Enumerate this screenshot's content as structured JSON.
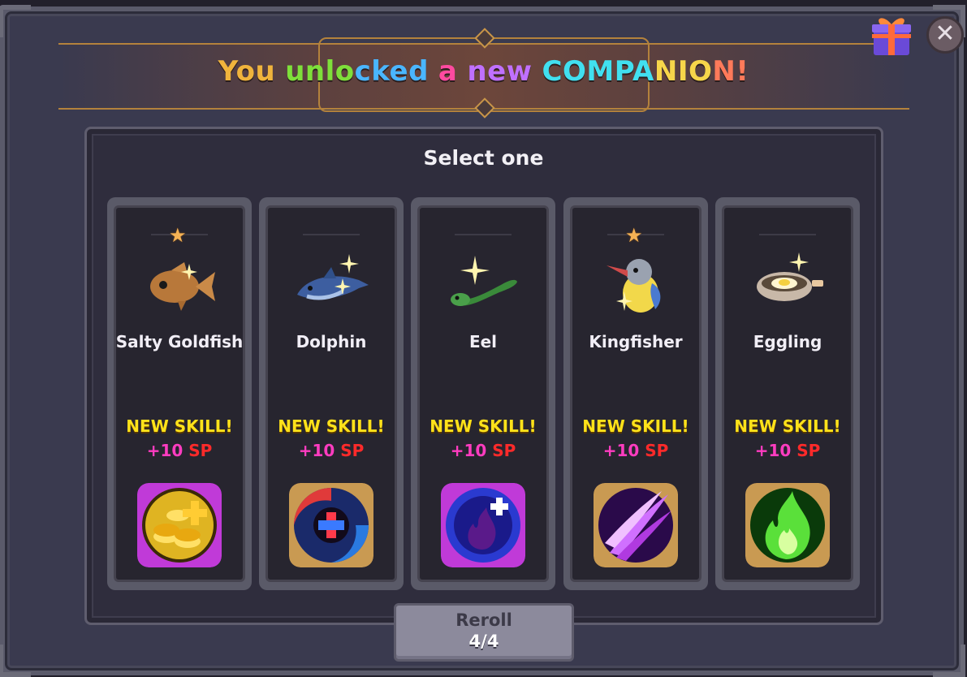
{
  "banner": {
    "title_parts": [
      {
        "text": "You",
        "color": "#f0b43c"
      },
      {
        "text": " ",
        "color": "#ffffff"
      },
      {
        "text": "unlo",
        "color": "#7ee03a"
      },
      {
        "text": "cked",
        "color": "#4ab6ff"
      },
      {
        "text": " ",
        "color": "#ffffff"
      },
      {
        "text": "a",
        "color": "#ff4aa0"
      },
      {
        "text": " ",
        "color": "#ffffff"
      },
      {
        "text": "new",
        "color": "#c070ff"
      },
      {
        "text": " ",
        "color": "#ffffff"
      },
      {
        "text": "COMPA",
        "color": "#41e0f0"
      },
      {
        "text": "NIO",
        "color": "#f7d64a"
      },
      {
        "text": "N!",
        "color": "#ff7a5a"
      }
    ]
  },
  "header": {
    "select_label": "Select one"
  },
  "cards": [
    {
      "name": "Salty Goldfish",
      "starred": true,
      "pet_icon": "goldfish-icon",
      "skill_label": "NEW SKILL!",
      "sp_plus": "+10",
      "sp_unit": "SP",
      "skill_icon": "gold-coins-icon",
      "skill_frame": "#c03ad8",
      "skill_glow": "#f2c326"
    },
    {
      "name": "Dolphin",
      "starred": false,
      "pet_icon": "dolphin-icon",
      "skill_label": "NEW SKILL!",
      "sp_plus": "+10",
      "sp_unit": "SP",
      "skill_icon": "vortex-heal-icon",
      "skill_frame": "#c99a52",
      "skill_glow": "#e03a3a"
    },
    {
      "name": "Eel",
      "starred": false,
      "pet_icon": "eel-icon",
      "skill_label": "NEW SKILL!",
      "sp_plus": "+10",
      "sp_unit": "SP",
      "skill_icon": "dark-flame-plus-icon",
      "skill_frame": "#c03ad8",
      "skill_glow": "#3a52e0"
    },
    {
      "name": "Kingfisher",
      "starred": true,
      "pet_icon": "kingfisher-icon",
      "skill_label": "NEW SKILL!",
      "sp_plus": "+10",
      "sp_unit": "SP",
      "skill_icon": "claw-slash-icon",
      "skill_frame": "#c99a52",
      "skill_glow": "#b03ae0"
    },
    {
      "name": "Eggling",
      "starred": false,
      "pet_icon": "eggling-icon",
      "skill_label": "NEW SKILL!",
      "sp_plus": "+10",
      "sp_unit": "SP",
      "skill_icon": "green-flame-icon",
      "skill_frame": "#c99a52",
      "skill_glow": "#5ae03a"
    }
  ],
  "reroll": {
    "label": "Reroll",
    "count": "4/4"
  },
  "close": {
    "label": "✕"
  },
  "gift": {
    "icon": "gift-box-icon"
  }
}
